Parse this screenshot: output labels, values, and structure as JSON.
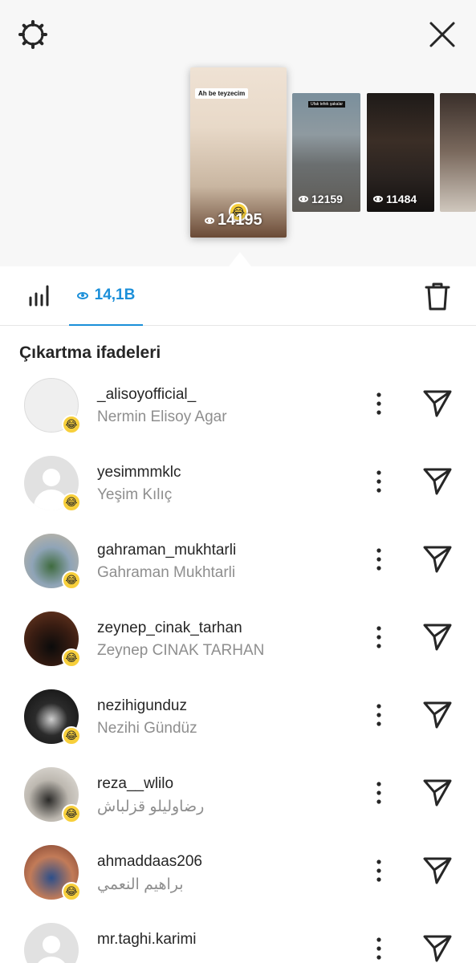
{
  "header": {
    "settings_icon": "gear-icon",
    "close_icon": "close-icon"
  },
  "stories": [
    {
      "caption": "Ah be teyzecim",
      "views": "14195",
      "selected": true
    },
    {
      "caption": "Ufak tefek şakalar",
      "views": "12159",
      "selected": false
    },
    {
      "caption": "",
      "views": "11484",
      "selected": false
    },
    {
      "caption": "",
      "views": "",
      "selected": false
    }
  ],
  "tabs": {
    "stats_icon": "bar-chart-icon",
    "views_count": "14,1B",
    "delete_icon": "trash-icon"
  },
  "section": {
    "title": "Çıkartma ifadeleri"
  },
  "viewers": [
    {
      "username": "_alisoyofficial_",
      "full_name": "Nermin Elisoy Agar"
    },
    {
      "username": "yesimmmklc",
      "full_name": "Yeşim Kılıç"
    },
    {
      "username": "gahraman_mukhtarli",
      "full_name": "Gahraman Mukhtarli"
    },
    {
      "username": "zeynep_cinak_tarhan",
      "full_name": "Zeynep CINAK TARHAN"
    },
    {
      "username": "nezihigunduz",
      "full_name": "Nezihi Gündüz"
    },
    {
      "username": "reza__wlilo",
      "full_name": "رضاولیلو قزلباش"
    },
    {
      "username": "ahmaddaas206",
      "full_name": "براهيم النعمي"
    },
    {
      "username": "mr.taghi.karimi",
      "full_name": ""
    }
  ],
  "colors": {
    "accent": "#1b8fd9",
    "sticker": "#f7cf3b"
  }
}
